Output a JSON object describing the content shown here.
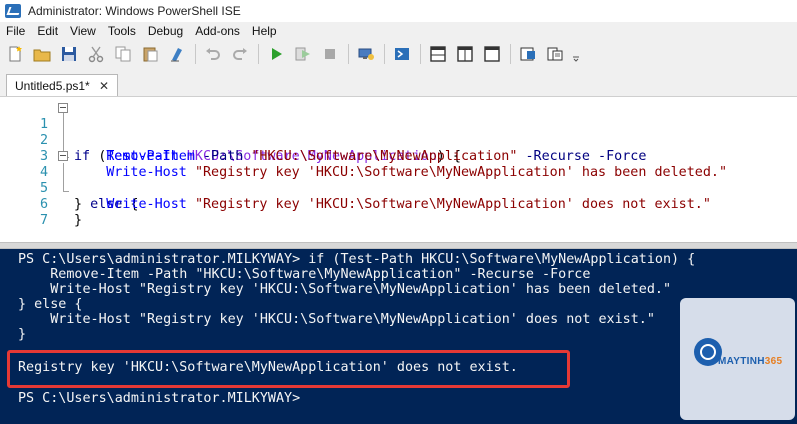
{
  "window": {
    "title": "Administrator: Windows PowerShell ISE"
  },
  "menu": [
    "File",
    "Edit",
    "View",
    "Tools",
    "Debug",
    "Add-ons",
    "Help"
  ],
  "toolbar_icons": [
    "new-file-icon",
    "open-folder-icon",
    "save-icon",
    "cut-icon",
    "copy-icon",
    "paste-icon",
    "clear-icon",
    "undo-icon",
    "redo-icon",
    "run-icon",
    "run-selection-icon",
    "stop-icon",
    "remote-icon",
    "powershell-icon",
    "layout-top-icon",
    "layout-right-icon",
    "layout-max-icon",
    "show-command-icon",
    "snippets-icon"
  ],
  "tab": {
    "label": "Untitled5.ps1*",
    "close": "✕"
  },
  "editor": {
    "line_numbers": [
      "1",
      "2",
      "3",
      "4",
      "5",
      "6",
      "7"
    ],
    "lines": [
      [
        {
          "t": "if ",
          "c": "kw"
        },
        {
          "t": "(",
          "c": "br"
        },
        {
          "t": "Test-Path",
          "c": "cm"
        },
        {
          "t": " ",
          "c": "br"
        },
        {
          "t": "HKCU:\\Software\\MyNewApplication",
          "c": "arg"
        },
        {
          "t": ") {",
          "c": "br"
        }
      ],
      [
        {
          "t": "    Remove-Item",
          "c": "cm"
        },
        {
          "t": " ",
          "c": "br"
        },
        {
          "t": "-Path",
          "c": "pm"
        },
        {
          "t": " ",
          "c": "br"
        },
        {
          "t": "\"HKCU:\\Software\\MyNewApplication\"",
          "c": "str"
        },
        {
          "t": " ",
          "c": "br"
        },
        {
          "t": "-Recurse",
          "c": "pm"
        },
        {
          "t": " ",
          "c": "br"
        },
        {
          "t": "-Force",
          "c": "pm"
        }
      ],
      [
        {
          "t": "    Write-Host",
          "c": "cm"
        },
        {
          "t": " ",
          "c": "br"
        },
        {
          "t": "\"Registry key 'HKCU:\\Software\\MyNewApplication' has been deleted.\"",
          "c": "str"
        }
      ],
      [
        {
          "t": "} ",
          "c": "br"
        },
        {
          "t": "else",
          "c": "kw"
        },
        {
          "t": " {",
          "c": "br"
        }
      ],
      [
        {
          "t": "    Write-Host",
          "c": "cm"
        },
        {
          "t": " ",
          "c": "br"
        },
        {
          "t": "\"Registry key 'HKCU:\\Software\\MyNewApplication' does not exist.\"",
          "c": "str"
        }
      ],
      [
        {
          "t": "}",
          "c": "br"
        }
      ],
      []
    ]
  },
  "console": {
    "lines": [
      "PS C:\\Users\\administrator.MILKYWAY> if (Test-Path HKCU:\\Software\\MyNewApplication) {",
      "    Remove-Item -Path \"HKCU:\\Software\\MyNewApplication\" -Recurse -Force",
      "    Write-Host \"Registry key 'HKCU:\\Software\\MyNewApplication' has been deleted.\"",
      "} else {",
      "    Write-Host \"Registry key 'HKCU:\\Software\\MyNewApplication' does not exist.\"",
      "}",
      "",
      "Registry key 'HKCU:\\Software\\MyNewApplication' does not exist.",
      "",
      "PS C:\\Users\\administrator.MILKYWAY>"
    ]
  },
  "watermark": {
    "brand": "MAYTINH",
    "brand_num": "365"
  },
  "colors": {
    "console_bg": "#012456",
    "highlight": "#e53935",
    "line_number": "#2b91af"
  }
}
